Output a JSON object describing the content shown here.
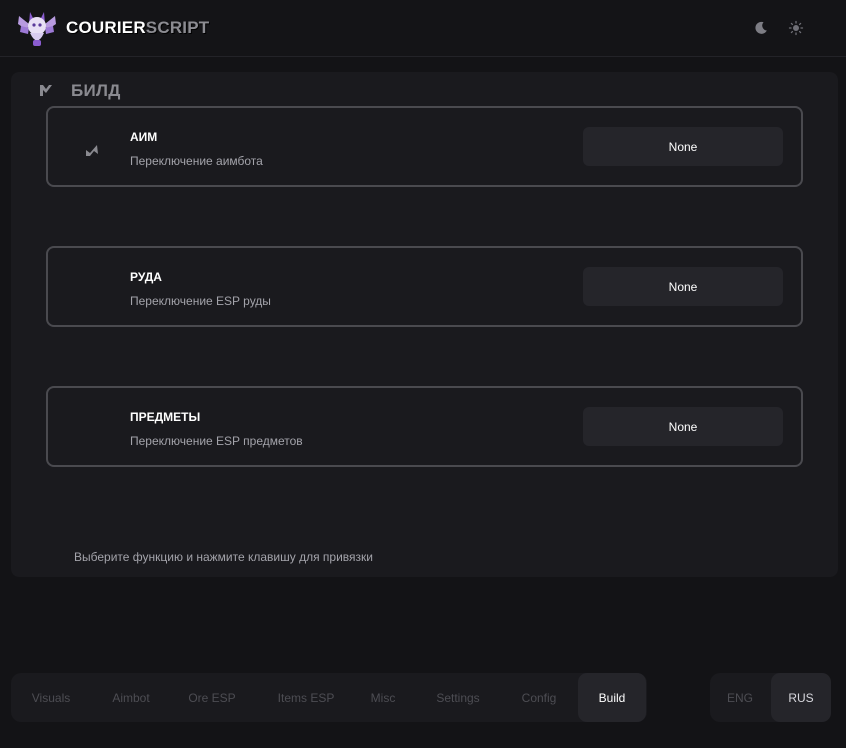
{
  "header": {
    "brand_primary": "COURIER",
    "brand_secondary": "SCRIPT"
  },
  "section": {
    "title": "БИЛД"
  },
  "cards": [
    {
      "title": "АИМ",
      "description": "Переключение аимбота",
      "key": "None"
    },
    {
      "title": "РУДА",
      "description": "Переключение ESP руды",
      "key": "None"
    },
    {
      "title": "ПРЕДМЕТЫ",
      "description": "Переключение ESP предметов",
      "key": "None"
    }
  ],
  "hint": "Выберите функцию и нажмите клавишу для привязки",
  "tabs": [
    {
      "label": "Visuals"
    },
    {
      "label": "Aimbot"
    },
    {
      "label": "Ore ESP"
    },
    {
      "label": "Items ESP"
    },
    {
      "label": "Misc"
    },
    {
      "label": "Settings"
    },
    {
      "label": "Config"
    },
    {
      "label": "Build",
      "active": true
    }
  ],
  "languages": [
    {
      "label": "ENG"
    },
    {
      "label": "RUS",
      "active": true
    }
  ],
  "colors": {
    "background": "#131316",
    "panel": "#1a1a1e",
    "card_border": "#4a4a4f",
    "button": "#25252a",
    "muted_text": "#a3a3aa",
    "inactive_tab": "#4d4d53",
    "logo_accent": "#8a5cd0"
  },
  "icons": {
    "logo": "winged-cat-logo-icon",
    "theme_dark": "moon-icon",
    "theme_light": "sun-icon",
    "section": "check-flag-icon",
    "aim_card": "arrow-up-right-icon"
  }
}
